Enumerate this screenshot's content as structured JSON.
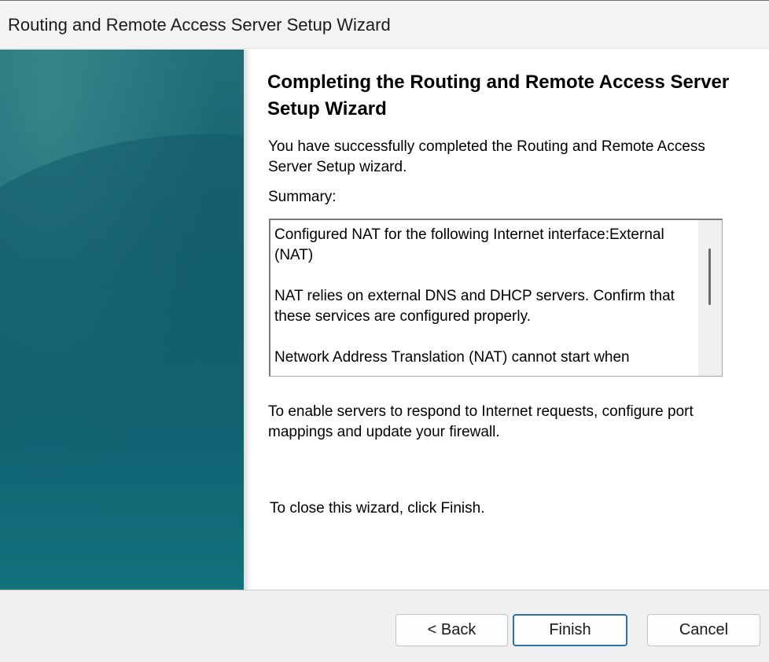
{
  "window": {
    "title": "Routing and Remote Access Server Setup Wizard"
  },
  "content": {
    "heading": "Completing the Routing and Remote Access Server Setup Wizard",
    "intro": "You have successfully completed the Routing and Remote Access Server Setup wizard.",
    "summary_label": "Summary:",
    "summary_text": "Configured NAT for the following Internet interface:External (NAT)\n\nNAT relies on external DNS and DHCP servers. Confirm that these services are configured properly.\n\nNetwork Address Translation (NAT) cannot start when",
    "port_note": "To enable servers to respond to Internet requests, configure port mappings and update your firewall.",
    "close_note": "To close this wizard, click Finish."
  },
  "buttons": {
    "back": "< Back",
    "finish": "Finish",
    "cancel": "Cancel"
  },
  "colors": {
    "side_panel": "#17606f",
    "focus_border": "#2d6fb4"
  }
}
